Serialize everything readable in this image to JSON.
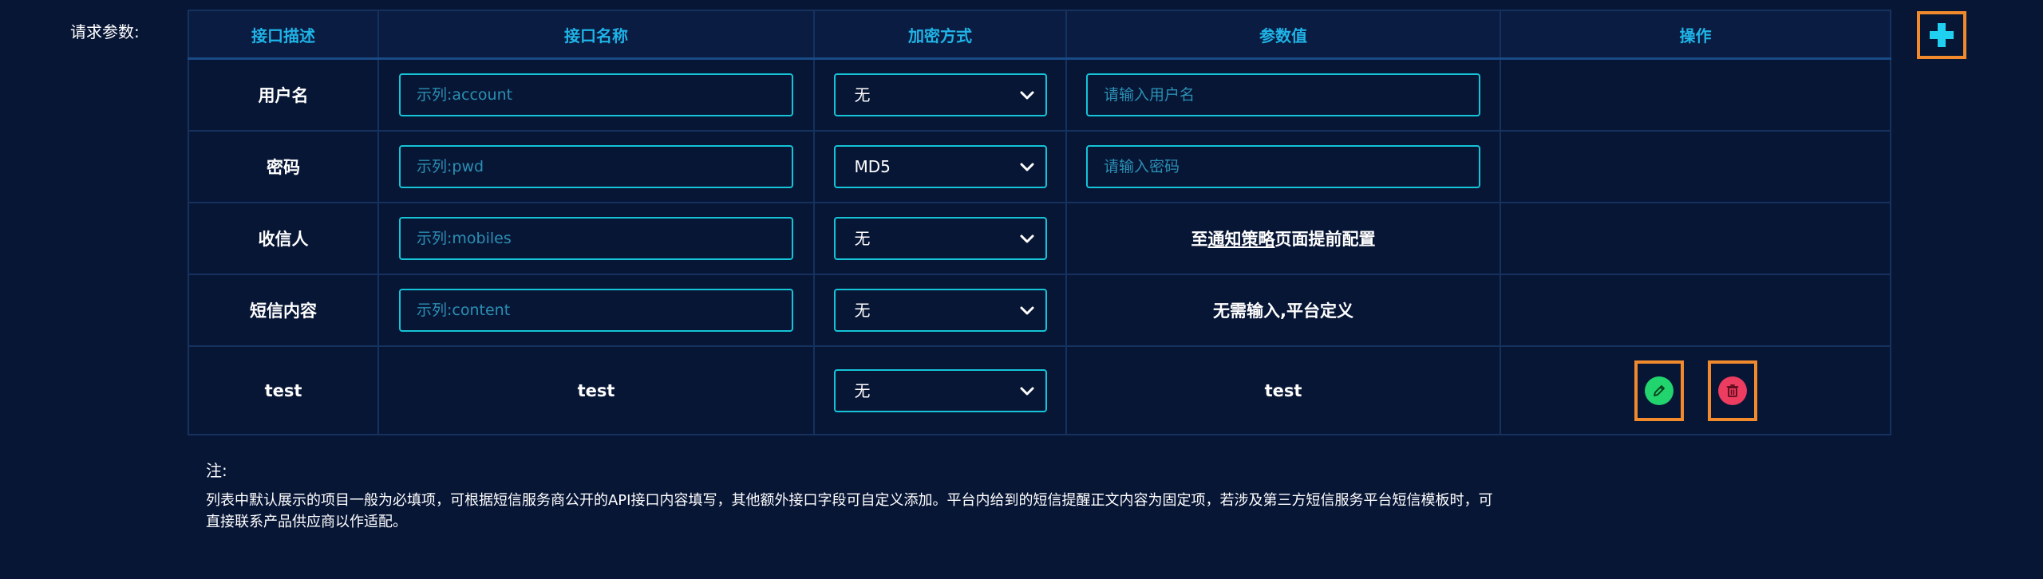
{
  "request_params_label": "请求参数:",
  "table": {
    "headers": [
      "接口描述",
      "接口名称",
      "加密方式",
      "参数值",
      "操作"
    ],
    "rows": [
      {
        "desc": "用户名",
        "name_placeholder": "示列:account",
        "encrypt": "无",
        "value_placeholder": "请输入用户名"
      },
      {
        "desc": "密码",
        "name_placeholder": "示列:pwd",
        "encrypt": "MD5",
        "value_placeholder": "请输入密码"
      },
      {
        "desc": "收信人",
        "name_placeholder": "示列:mobiles",
        "encrypt": "无",
        "value_prefix": "至",
        "value_link": "通知策略",
        "value_suffix": "页面提前配置"
      },
      {
        "desc": "短信内容",
        "name_placeholder": "示列:content",
        "encrypt": "无",
        "value_text": "无需输入,平台定义"
      },
      {
        "desc": "test",
        "name_text": "test",
        "encrypt": "无",
        "value_text": "test"
      }
    ]
  },
  "icons": {
    "add": "plus-icon",
    "edit": "pencil-icon",
    "delete": "trash-icon",
    "dropdown": "chevron-down-icon"
  },
  "colors": {
    "background": "#081636",
    "header_text": "#1fb3e6",
    "input_border": "#15c4d6",
    "highlight_border": "#f08a2c",
    "edit_green": "#21d46d",
    "delete_red": "#ec3c5f"
  },
  "note": {
    "title": "注:",
    "line1": "列表中默认展示的项目一般为必填项，可根据短信服务商公开的API接口内容填写，其他额外接口字段可自定义添加。平台内给到的短信提醒正文内容为固定项，若涉及第三方短信服务平台短信模板时，可",
    "line2": "直接联系产品供应商以作适配。"
  }
}
